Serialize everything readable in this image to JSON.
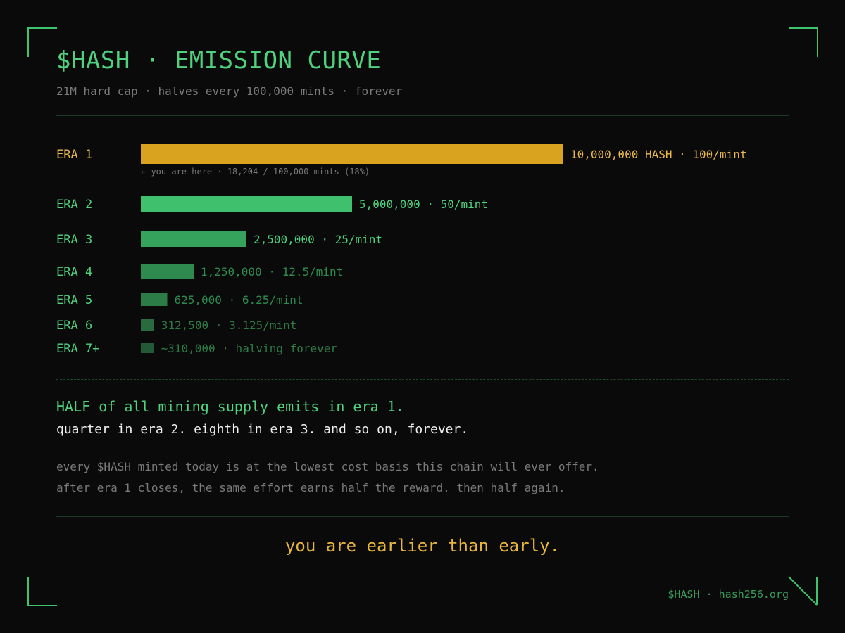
{
  "header": {
    "title": "$HASH · EMISSION CURVE",
    "subtitle": "21M hard cap · halves every 100,000 mints · forever"
  },
  "chart_data": {
    "type": "bar",
    "orientation": "horizontal",
    "categories": [
      "ERA 1",
      "ERA 2",
      "ERA 3",
      "ERA 4",
      "ERA 5",
      "ERA 6",
      "ERA 7+"
    ],
    "values": [
      10000000,
      5000000,
      2500000,
      1250000,
      625000,
      312500,
      310000
    ],
    "data_labels": [
      "10,000,000 HASH · 100/mint",
      "5,000,000 · 50/mint",
      "2,500,000 · 25/mint",
      "1,250,000 · 12.5/mint",
      "625,000 · 6.25/mint",
      "312,500 · 3.125/mint",
      "~310,000 · halving forever"
    ],
    "annotation": "← you are here · 18,204 / 100,000 mints (18%)",
    "current_era_index": 0,
    "colors": {
      "current": "#d9a21f",
      "current_label": "#eab84a",
      "bars": [
        "#d9a21f",
        "#3fc06d",
        "#35a35c",
        "#2e8a4e",
        "#2b7c47",
        "#276b3f",
        "#235a36"
      ],
      "labels": [
        "#eab84a",
        "#4fd17e",
        "#4fd17e",
        "#2e8a4e",
        "#2e8a4e",
        "#2e7a47",
        "#2e7a47"
      ],
      "era_label": "#4fd17e"
    }
  },
  "narrative": {
    "headline": "HALF of all mining supply emits in era 1.",
    "line2": "quarter in era 2. eighth in era 3. and so on, forever.",
    "para1": "every $HASH minted today is at the lowest cost basis this chain will ever offer.",
    "para2": "after era 1 closes, the same effort earns half the reward. then half again.",
    "tagline": "you are earlier than early."
  },
  "footer": {
    "text": "$HASH · hash256.org"
  },
  "colors": {
    "background": "#0a0a0a",
    "accent_green": "#4fd17e",
    "accent_gold": "#e9b53a"
  }
}
